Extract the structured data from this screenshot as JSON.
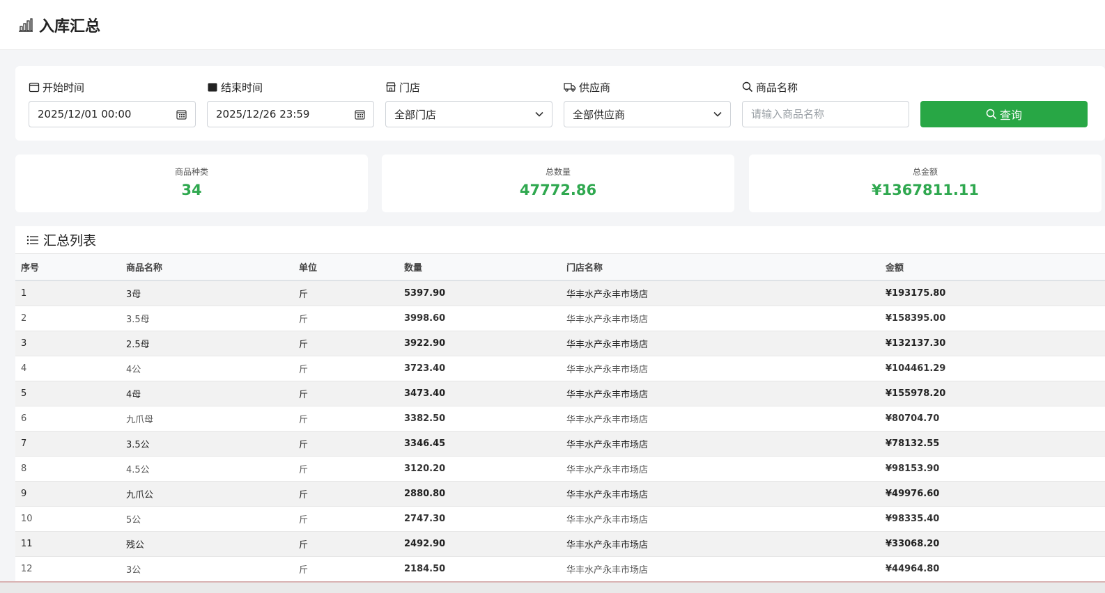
{
  "header": {
    "title": "入库汇总",
    "icon": "bar-chart-icon"
  },
  "filters": {
    "start_time": {
      "label": "开始时间",
      "value": "2025/12/01 00:00"
    },
    "end_time": {
      "label": "结束时间",
      "value": "2025/12/26 23:59"
    },
    "store": {
      "label": "门店",
      "value": "全部门店"
    },
    "supplier": {
      "label": "供应商",
      "value": "全部供应商"
    },
    "product": {
      "label": "商品名称",
      "placeholder": "请输入商品名称"
    },
    "query_label": "查询"
  },
  "stats": [
    {
      "label": "商品种类",
      "value": "34"
    },
    {
      "label": "总数量",
      "value": "47772.86"
    },
    {
      "label": "总金额",
      "value": "¥1367811.11"
    }
  ],
  "list": {
    "title": "汇总列表",
    "columns": [
      "序号",
      "商品名称",
      "单位",
      "数量",
      "门店名称",
      "金额"
    ],
    "rows": [
      [
        "1",
        "3母",
        "斤",
        "5397.90",
        "华丰水产永丰市场店",
        "¥193175.80"
      ],
      [
        "2",
        "3.5母",
        "斤",
        "3998.60",
        "华丰水产永丰市场店",
        "¥158395.00"
      ],
      [
        "3",
        "2.5母",
        "斤",
        "3922.90",
        "华丰水产永丰市场店",
        "¥132137.30"
      ],
      [
        "4",
        "4公",
        "斤",
        "3723.40",
        "华丰水产永丰市场店",
        "¥104461.29"
      ],
      [
        "5",
        "4母",
        "斤",
        "3473.40",
        "华丰水产永丰市场店",
        "¥155978.20"
      ],
      [
        "6",
        "九爪母",
        "斤",
        "3382.50",
        "华丰水产永丰市场店",
        "¥80704.70"
      ],
      [
        "7",
        "3.5公",
        "斤",
        "3346.45",
        "华丰水产永丰市场店",
        "¥78132.55"
      ],
      [
        "8",
        "4.5公",
        "斤",
        "3120.20",
        "华丰水产永丰市场店",
        "¥98153.90"
      ],
      [
        "9",
        "九爪公",
        "斤",
        "2880.80",
        "华丰水产永丰市场店",
        "¥49976.60"
      ],
      [
        "10",
        "5公",
        "斤",
        "2747.30",
        "华丰水产永丰市场店",
        "¥98335.40"
      ],
      [
        "11",
        "残公",
        "斤",
        "2492.90",
        "华丰水产永丰市场店",
        "¥33068.20"
      ],
      [
        "12",
        "3公",
        "斤",
        "2184.50",
        "华丰水产永丰市场店",
        "¥44964.80"
      ]
    ]
  },
  "colors": {
    "accent": "#28a745",
    "stat_value": "#2fa84f"
  }
}
